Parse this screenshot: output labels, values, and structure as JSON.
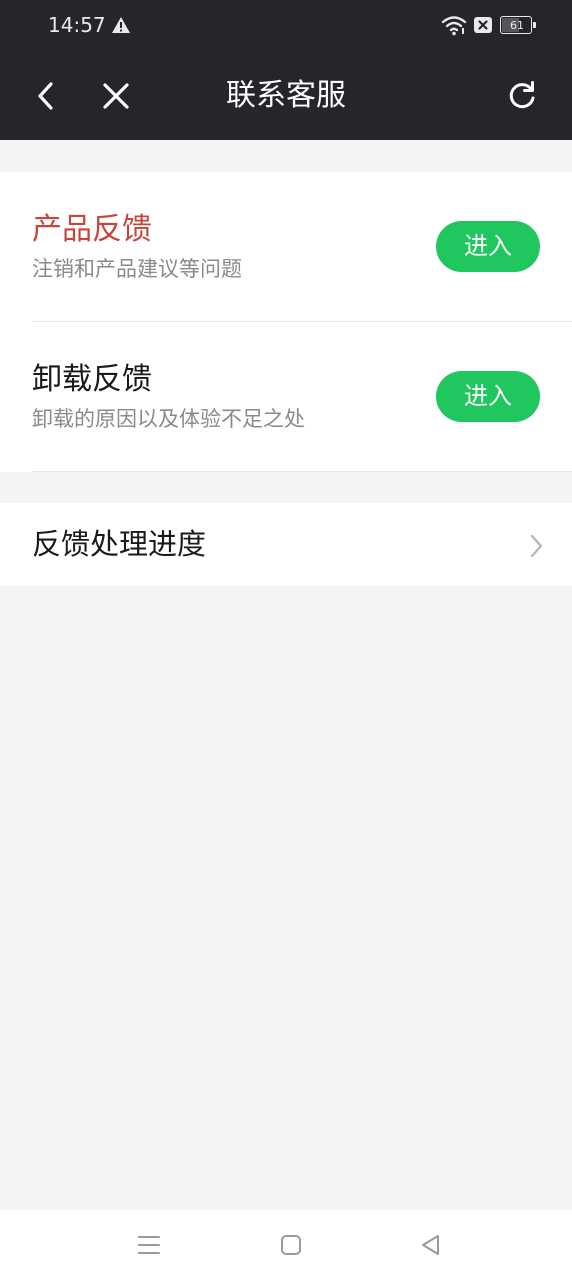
{
  "status_bar": {
    "time": "14:57",
    "battery_level": "61",
    "icons": [
      "warning-icon",
      "wifi-icon",
      "sim-blocked-icon",
      "battery-icon"
    ]
  },
  "nav": {
    "title": "联系客服",
    "icons": [
      "back-chevron-icon",
      "close-icon",
      "refresh-icon"
    ]
  },
  "feedback_items": [
    {
      "title": "产品反馈",
      "subtitle": "注销和产品建议等问题",
      "button_label": "进入",
      "title_color": "#c8453d"
    },
    {
      "title": "卸载反馈",
      "subtitle": "卸载的原因以及体验不足之处",
      "button_label": "进入",
      "title_color": "#1a1a1a"
    }
  ],
  "progress_row": {
    "label": "反馈处理进度"
  },
  "colors": {
    "header_bg": "#25262b",
    "accent_green": "#20c65e",
    "page_bg": "#f4f4f4"
  }
}
